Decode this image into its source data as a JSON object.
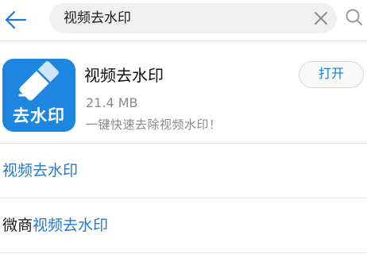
{
  "search": {
    "query": "视频去水印",
    "back_icon": "arrow-left-icon",
    "clear_icon": "close-icon",
    "search_icon": "search-icon"
  },
  "app": {
    "name": "视频去水印",
    "icon_text": "去水印",
    "size": "21.4 MB",
    "description": "一键快速去除视频水印！",
    "open_label": "打开"
  },
  "suggestions": [
    {
      "prefix": "",
      "match": "视频去水印"
    },
    {
      "prefix": "微商",
      "match": "视频去水印"
    }
  ],
  "colors": {
    "accent": "#1e7ad6",
    "icon_bg": "#1e86e0",
    "search_bg": "#f0f0f0"
  }
}
